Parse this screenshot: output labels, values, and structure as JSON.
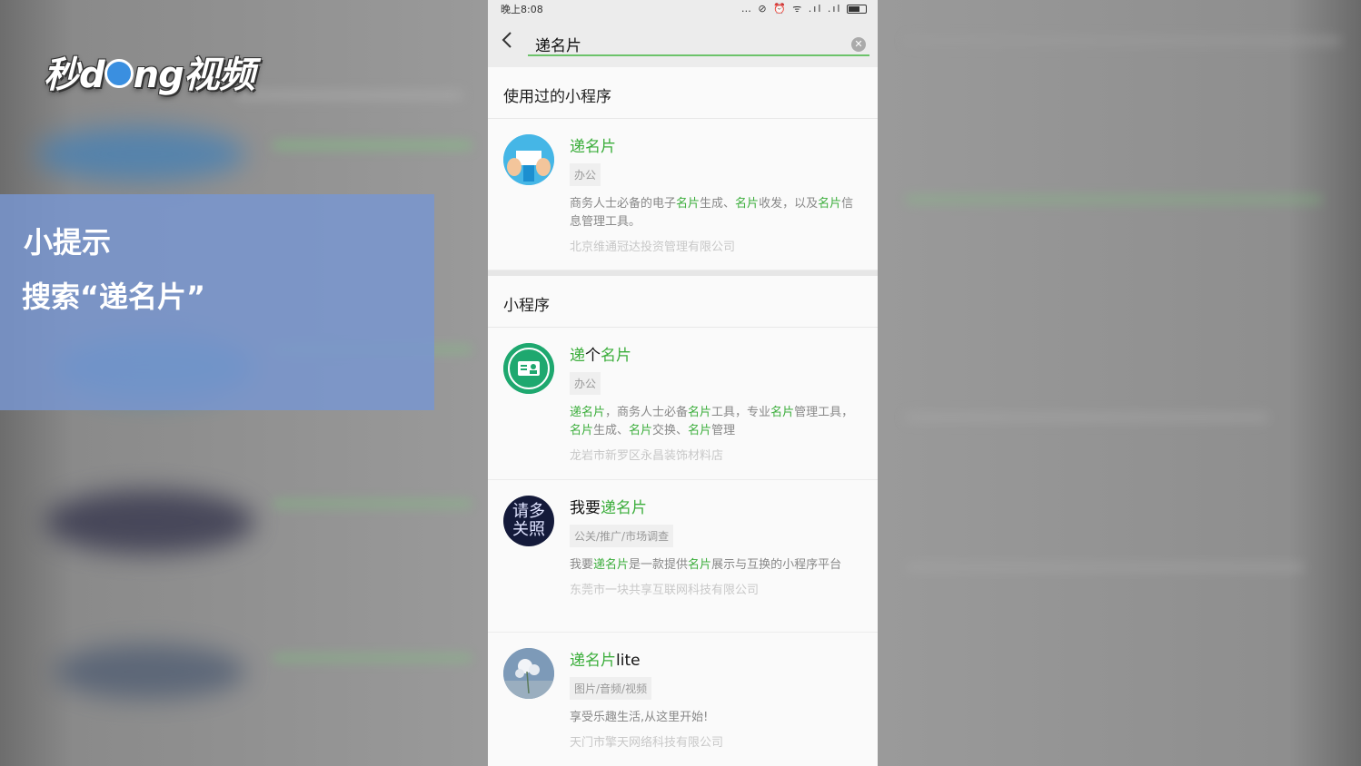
{
  "watermark": {
    "logo_text_a": "秒",
    "logo_text_b": "d",
    "logo_text_c": "ng视频"
  },
  "tip": {
    "title": "小提示",
    "body": "搜索“递名片”"
  },
  "status_bar": {
    "time": "晚上8:08",
    "icons": "… ⊘ ⏰ ᯤ .ıl .ıl"
  },
  "search": {
    "value": "递名片"
  },
  "sections": {
    "used_title": "使用过的小程序",
    "mini_title": "小程序"
  },
  "used_items": [
    {
      "name_parts": [
        "递名片"
      ],
      "tag": "办公",
      "desc": [
        "商务人士必备的电子",
        "名片",
        "生成、",
        "名片",
        "收发，以及",
        "名片",
        "信息管理工具。"
      ],
      "company": "北京维通冠达投资管理有限公司"
    }
  ],
  "items": [
    {
      "name_hl_1": "递",
      "name_plain": "个",
      "name_hl_2": "名片",
      "tag": "办公",
      "desc": [
        "递名片",
        "，商务人士必备",
        "名片",
        "工具，专业",
        "名片",
        "管理工具，",
        "名片",
        "生成、",
        "名片",
        "交换、",
        "名片",
        "管理"
      ],
      "company": "龙岩市新罗区永昌装饰材料店"
    },
    {
      "name_plain": "我要",
      "name_hl": "递名片",
      "tag": "公关/推广/市场调查",
      "desc": [
        "我要",
        "递名片",
        "是一款提供",
        "名片",
        "展示与互换的小程序平台"
      ],
      "company": "东莞市一块共享互联网科技有限公司",
      "avatar_text": "请多关照"
    },
    {
      "name_hl": "递名片",
      "name_plain": "lite",
      "tag": "图片/音频/视频",
      "desc": "享受乐趣生活,从这里开始!",
      "company": "天门市擎天网络科技有限公司"
    }
  ],
  "colors": {
    "highlight": "#3cae3c",
    "underline": "#6cc36a",
    "tip_bg": "#7896d2"
  }
}
